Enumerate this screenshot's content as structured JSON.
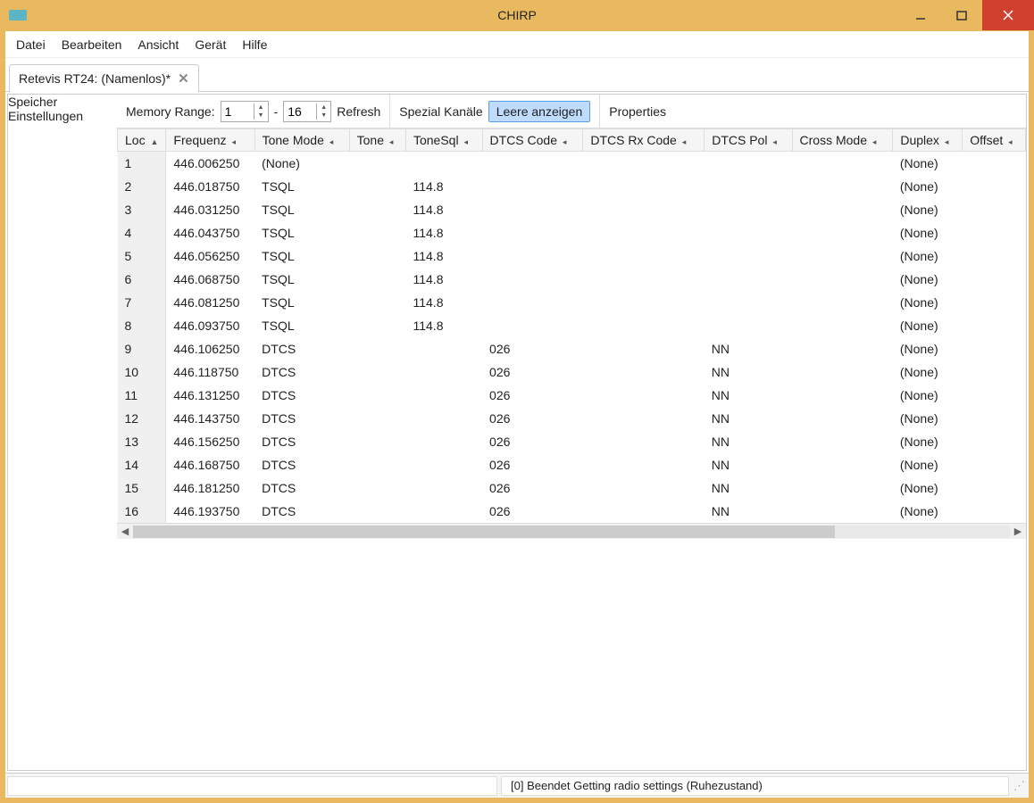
{
  "window": {
    "title": "CHIRP"
  },
  "menubar": [
    "Datei",
    "Bearbeiten",
    "Ansicht",
    "Gerät",
    "Hilfe"
  ],
  "tab": {
    "label": "Retevis RT24: (Namenlos)*"
  },
  "side": {
    "speicher": "Speicher",
    "einstellungen": "Einstellungen"
  },
  "toolbar": {
    "memory_range_label": "Memory Range:",
    "range_from": "1",
    "range_to": "16",
    "refresh": "Refresh",
    "spezial": "Spezial Kanäle",
    "leere": "Leere anzeigen",
    "properties": "Properties",
    "dash": "-"
  },
  "columns": [
    "Loc",
    "Frequenz",
    "Tone Mode",
    "Tone",
    "ToneSql",
    "DTCS Code",
    "DTCS Rx Code",
    "DTCS Pol",
    "Cross Mode",
    "Duplex",
    "Offset"
  ],
  "sort_asc_col": 0,
  "rows": [
    {
      "loc": "1",
      "freq": "446.006250",
      "tmode": "(None)",
      "tone": "",
      "tsql": "",
      "dtcs": "",
      "dtcsrx": "",
      "dtcspol": "",
      "cross": "",
      "duplex": "(None)",
      "offset": ""
    },
    {
      "loc": "2",
      "freq": "446.018750",
      "tmode": "TSQL",
      "tone": "",
      "tsql": "114.8",
      "dtcs": "",
      "dtcsrx": "",
      "dtcspol": "",
      "cross": "",
      "duplex": "(None)",
      "offset": ""
    },
    {
      "loc": "3",
      "freq": "446.031250",
      "tmode": "TSQL",
      "tone": "",
      "tsql": "114.8",
      "dtcs": "",
      "dtcsrx": "",
      "dtcspol": "",
      "cross": "",
      "duplex": "(None)",
      "offset": ""
    },
    {
      "loc": "4",
      "freq": "446.043750",
      "tmode": "TSQL",
      "tone": "",
      "tsql": "114.8",
      "dtcs": "",
      "dtcsrx": "",
      "dtcspol": "",
      "cross": "",
      "duplex": "(None)",
      "offset": ""
    },
    {
      "loc": "5",
      "freq": "446.056250",
      "tmode": "TSQL",
      "tone": "",
      "tsql": "114.8",
      "dtcs": "",
      "dtcsrx": "",
      "dtcspol": "",
      "cross": "",
      "duplex": "(None)",
      "offset": ""
    },
    {
      "loc": "6",
      "freq": "446.068750",
      "tmode": "TSQL",
      "tone": "",
      "tsql": "114.8",
      "dtcs": "",
      "dtcsrx": "",
      "dtcspol": "",
      "cross": "",
      "duplex": "(None)",
      "offset": ""
    },
    {
      "loc": "7",
      "freq": "446.081250",
      "tmode": "TSQL",
      "tone": "",
      "tsql": "114.8",
      "dtcs": "",
      "dtcsrx": "",
      "dtcspol": "",
      "cross": "",
      "duplex": "(None)",
      "offset": ""
    },
    {
      "loc": "8",
      "freq": "446.093750",
      "tmode": "TSQL",
      "tone": "",
      "tsql": "114.8",
      "dtcs": "",
      "dtcsrx": "",
      "dtcspol": "",
      "cross": "",
      "duplex": "(None)",
      "offset": ""
    },
    {
      "loc": "9",
      "freq": "446.106250",
      "tmode": "DTCS",
      "tone": "",
      "tsql": "",
      "dtcs": "026",
      "dtcsrx": "",
      "dtcspol": "NN",
      "cross": "",
      "duplex": "(None)",
      "offset": ""
    },
    {
      "loc": "10",
      "freq": "446.118750",
      "tmode": "DTCS",
      "tone": "",
      "tsql": "",
      "dtcs": "026",
      "dtcsrx": "",
      "dtcspol": "NN",
      "cross": "",
      "duplex": "(None)",
      "offset": ""
    },
    {
      "loc": "11",
      "freq": "446.131250",
      "tmode": "DTCS",
      "tone": "",
      "tsql": "",
      "dtcs": "026",
      "dtcsrx": "",
      "dtcspol": "NN",
      "cross": "",
      "duplex": "(None)",
      "offset": ""
    },
    {
      "loc": "12",
      "freq": "446.143750",
      "tmode": "DTCS",
      "tone": "",
      "tsql": "",
      "dtcs": "026",
      "dtcsrx": "",
      "dtcspol": "NN",
      "cross": "",
      "duplex": "(None)",
      "offset": ""
    },
    {
      "loc": "13",
      "freq": "446.156250",
      "tmode": "DTCS",
      "tone": "",
      "tsql": "",
      "dtcs": "026",
      "dtcsrx": "",
      "dtcspol": "NN",
      "cross": "",
      "duplex": "(None)",
      "offset": ""
    },
    {
      "loc": "14",
      "freq": "446.168750",
      "tmode": "DTCS",
      "tone": "",
      "tsql": "",
      "dtcs": "026",
      "dtcsrx": "",
      "dtcspol": "NN",
      "cross": "",
      "duplex": "(None)",
      "offset": ""
    },
    {
      "loc": "15",
      "freq": "446.181250",
      "tmode": "DTCS",
      "tone": "",
      "tsql": "",
      "dtcs": "026",
      "dtcsrx": "",
      "dtcspol": "NN",
      "cross": "",
      "duplex": "(None)",
      "offset": ""
    },
    {
      "loc": "16",
      "freq": "446.193750",
      "tmode": "DTCS",
      "tone": "",
      "tsql": "",
      "dtcs": "026",
      "dtcsrx": "",
      "dtcspol": "NN",
      "cross": "",
      "duplex": "(None)",
      "offset": ""
    }
  ],
  "status": {
    "text": "[0] Beendet Getting radio settings (Ruhezustand)"
  }
}
